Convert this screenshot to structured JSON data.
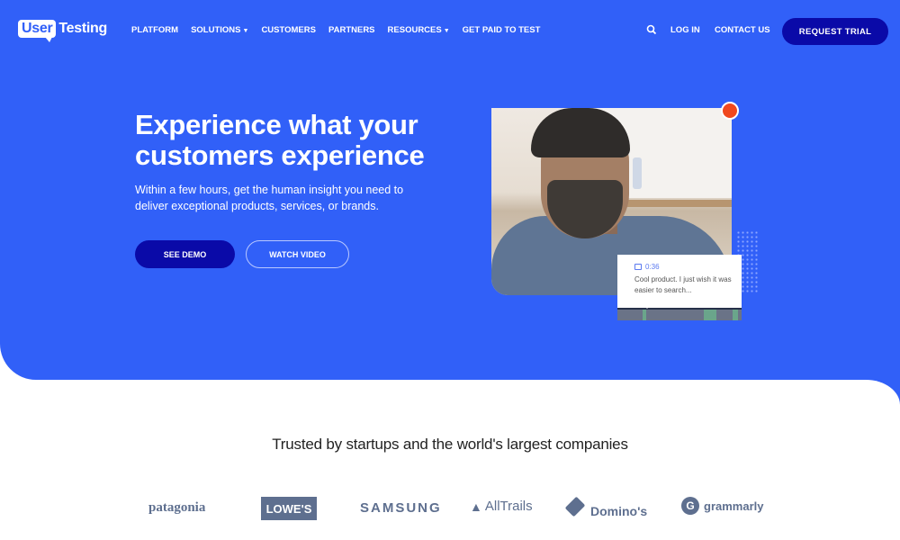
{
  "brand": {
    "logo_part1": "User",
    "logo_part2": "Testing"
  },
  "nav": {
    "items": [
      {
        "label": "PLATFORM",
        "dropdown": false
      },
      {
        "label": "SOLUTIONS",
        "dropdown": true
      },
      {
        "label": "CUSTOMERS",
        "dropdown": false
      },
      {
        "label": "PARTNERS",
        "dropdown": false
      },
      {
        "label": "RESOURCES",
        "dropdown": true
      },
      {
        "label": "GET PAID TO TEST",
        "dropdown": false
      }
    ],
    "search_icon": "search-icon",
    "login": "LOG IN",
    "contact": "CONTACT US",
    "trial": "REQUEST TRIAL"
  },
  "hero": {
    "headline": "Experience what your customers experience",
    "subtext": "Within a few hours, get the human insight you need to deliver exceptional products, services, or brands.",
    "demo_button": "SEE DEMO",
    "video_button": "WATCH VIDEO",
    "comment": {
      "time": "0:36",
      "text": "Cool product. I just wish it was easier to search..."
    }
  },
  "colors": {
    "hero_bg": "#3160f8",
    "primary_button": "#0a0aa8",
    "record": "#f0481e",
    "logo_gray": "#5e6f8f"
  },
  "trusted": {
    "heading": "Trusted by startups and the world's largest companies",
    "logos": [
      "patagonia",
      "LOWE'S",
      "SAMSUNG",
      "AllTrails",
      "Domino's",
      "grammarly"
    ]
  }
}
